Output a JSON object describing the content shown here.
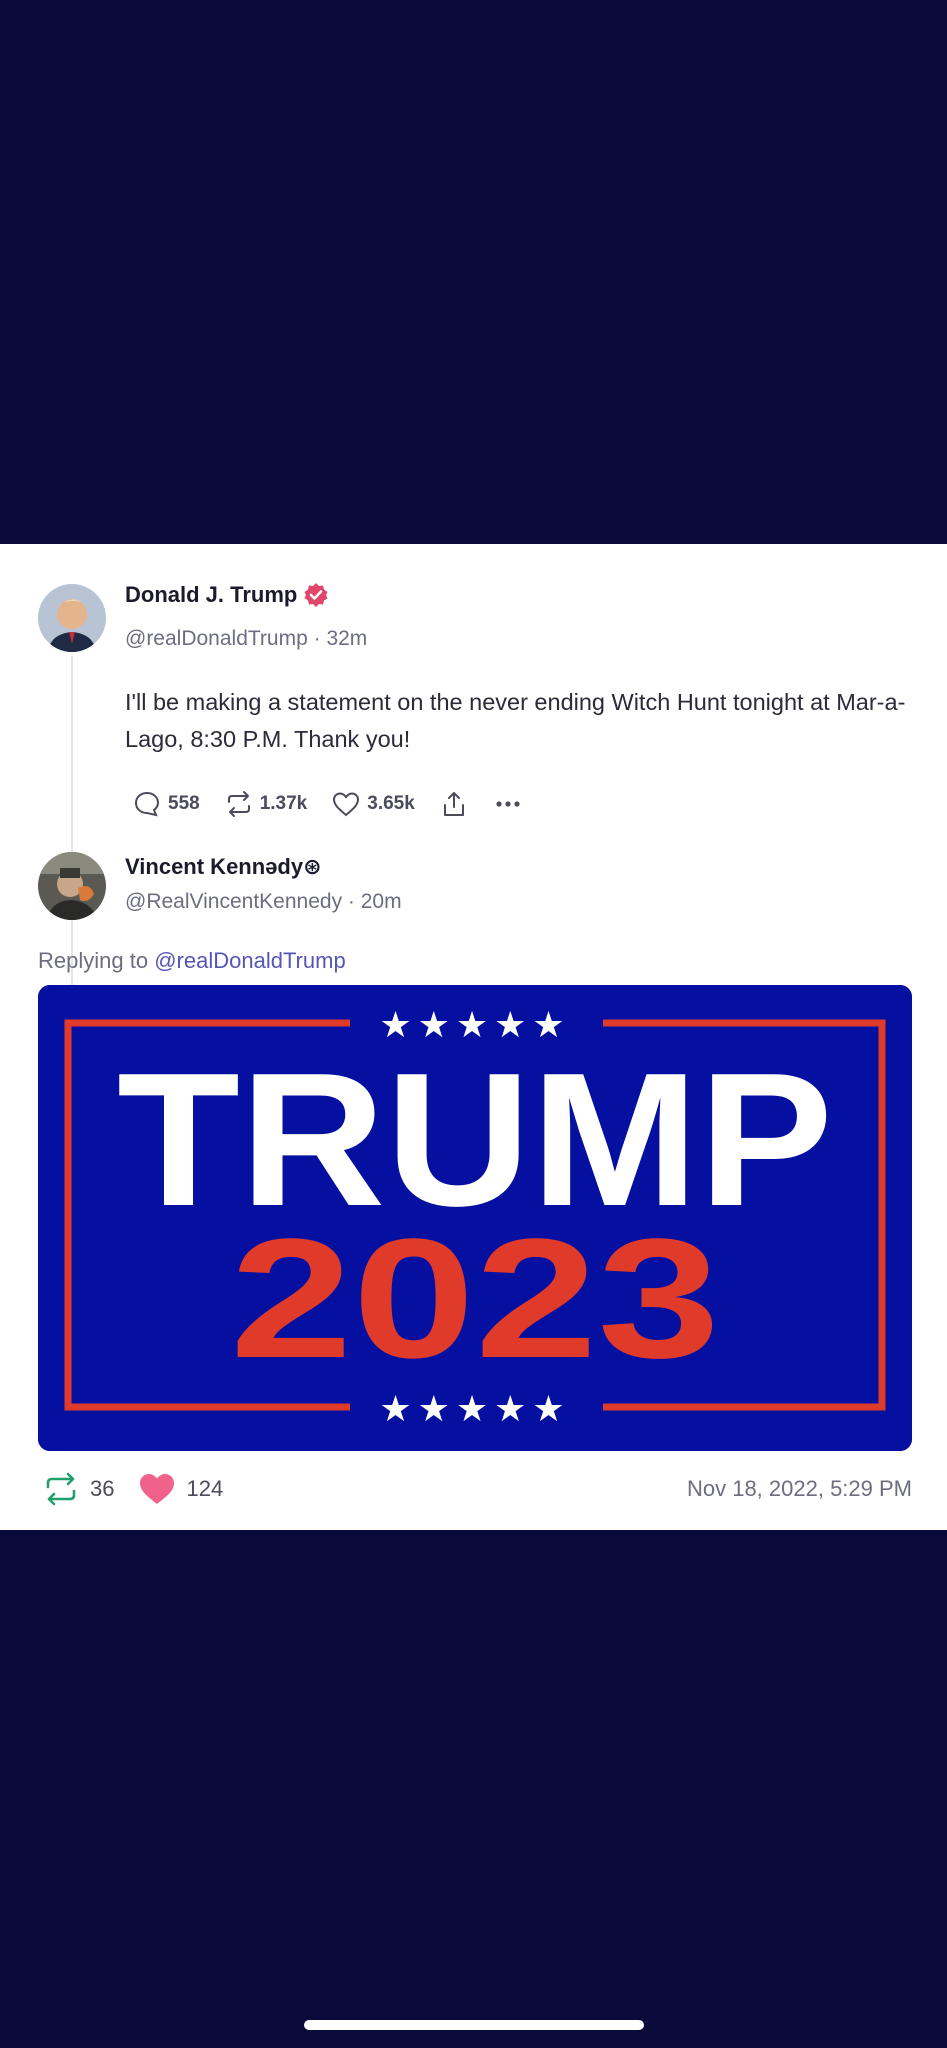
{
  "colors": {
    "background": "#0a0a3a",
    "card": "#ffffff",
    "verified_badge": "#e0476a",
    "mention": "#5656b8",
    "retweet_green": "#22a06b",
    "like_pink": "#f0628a",
    "banner_blue": "#0510a0",
    "banner_red": "#e03a2a"
  },
  "parent_post": {
    "author_name": "Donald J. Trump",
    "verified_icon": "verified-badge-icon",
    "handle_time": "@realDonaldTrump · 32m",
    "text": "I'll be making a statement on the never ending Witch Hunt tonight at Mar-a-Lago, 8:30 P.M. Thank you!",
    "replies": "558",
    "reposts": "1.37k",
    "likes": "3.65k"
  },
  "reply_post": {
    "author_name": "Vincent Kennədy⊛",
    "handle_time": "@RealVincentKennedy · 20m",
    "replying_prefix": "Replying to",
    "replying_mention": "@realDonaldTrump",
    "image": {
      "line1": "TRUMP",
      "line2": "2023",
      "stars": "★★★★★"
    },
    "reposts": "36",
    "likes": "124",
    "timestamp": "Nov 18, 2022, 5:29 PM"
  }
}
